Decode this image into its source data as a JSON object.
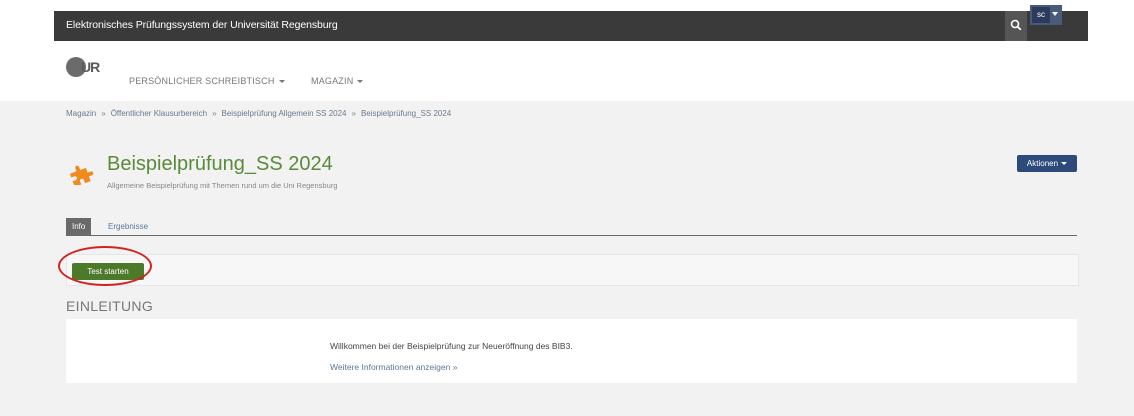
{
  "header": {
    "app_title": "Elektronisches Prüfungssystem der Universität Regensburg",
    "user_initials": "sc",
    "search_icon": "search-icon"
  },
  "nav": {
    "logo_text": "UR",
    "items": [
      {
        "label": "PERSÖNLICHER SCHREIBTISCH"
      },
      {
        "label": "MAGAZIN"
      }
    ]
  },
  "breadcrumb": {
    "items": [
      "Magazin",
      "Öffentlicher Klausurbereich",
      "Beispielprüfung Allgemein SS 2024",
      "Beispielprüfung_SS 2024"
    ],
    "separator": "»"
  },
  "page": {
    "title": "Beispielprüfung_SS 2024",
    "description": "Allgemeine Beispielprüfung mit Themen rund um die Uni Regensburg",
    "actions_label": "Aktionen",
    "icon": "puzzle-icon",
    "icon_color": "#f08a1e"
  },
  "tabs": [
    {
      "label": "Info",
      "active": true
    },
    {
      "label": "Ergebnisse",
      "active": false
    }
  ],
  "toolbar": {
    "start_label": "Test starten"
  },
  "intro": {
    "section_title": "EINLEITUNG",
    "text": "Willkommen bei der Beispielprüfung zur Neueröffnung des BIB3.",
    "link": "Weitere Informationen anzeigen »"
  },
  "colors": {
    "topbar": "#3a3a3a",
    "accent_green": "#4d7a2a",
    "title_green": "#5a8a3a",
    "actions_blue": "#2c4a7a",
    "highlight_red": "#d42020"
  }
}
